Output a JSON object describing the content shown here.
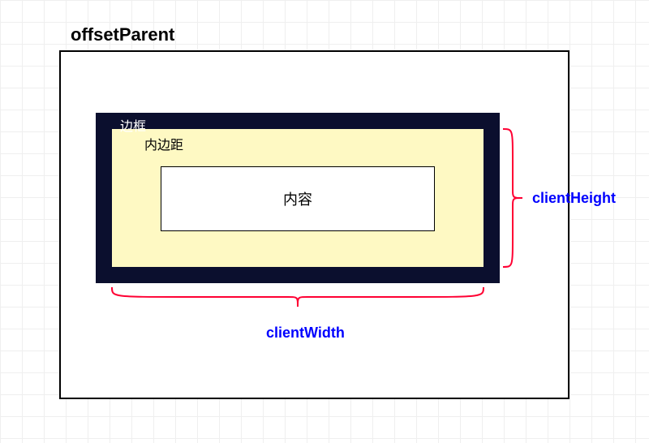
{
  "labels": {
    "offsetParent": "offsetParent",
    "border": "边框",
    "padding": "内边距",
    "content": "内容",
    "clientHeight": "clientHeight",
    "clientWidth": "clientWidth"
  }
}
